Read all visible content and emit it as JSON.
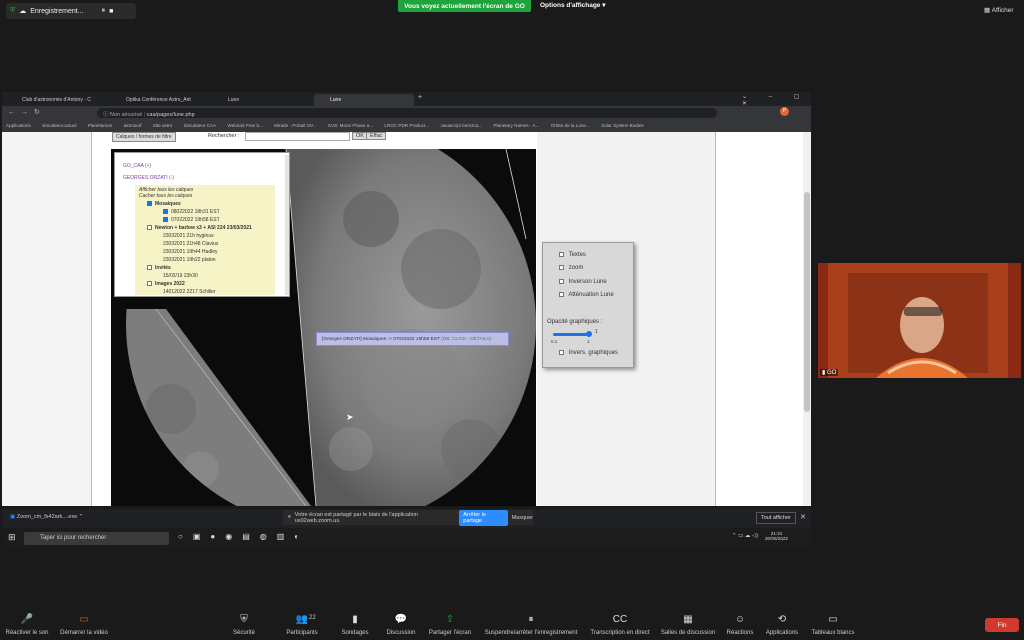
{
  "zoom_top": {
    "recording_label": "Enregistrement...",
    "share_banner": "Vous voyez actuellement l'écran de GO",
    "view_options": "Options d'affichage",
    "show_label": "Afficher"
  },
  "browser": {
    "tabs": [
      "Club d'astronomie d'Antony - C",
      "Optika Conférence Astro_Ant",
      "Lune",
      "Lune"
    ],
    "not_secure": "Non sécurisé",
    "url": "caa/pages/lune.php",
    "bookmarks": [
      "Applications",
      "simulateur.actuel",
      "Planétarium",
      "astrosurf",
      "Site astro",
      "Simulateur CAA",
      "Webirad Free b...",
      "Mirade - Portail OV...",
      "SVS: Moon Phase a...",
      "LROC PDR Product...",
      "Javascript tiers2ca...",
      "Planetary Names - A...",
      "Orbite de la Lune...",
      "Solar System Bodies"
    ]
  },
  "page": {
    "search_label": "Rechercher :",
    "btn_ok": "OK",
    "btn_clear": "Effac",
    "btn_top": "Calques / formes de filtre"
  },
  "layers": {
    "group1": "GO_CAA (+)",
    "group2": "GEORGES ORZATI (-)",
    "show_all": "Afficher tous les calques",
    "hide_all": "Cacher tous les calques",
    "items": [
      {
        "label": "Mosaiques",
        "checked": true,
        "bold": true,
        "indent": 0
      },
      {
        "label": "08022022 18h31 EST",
        "checked": true,
        "bold": false,
        "indent": 1
      },
      {
        "label": "07022022 19h58 EST",
        "checked": true,
        "bold": false,
        "indent": 1
      },
      {
        "label": "Newton + barlow x3 + ASI 224 23/03/2021",
        "checked": false,
        "bold": true,
        "indent": 0
      },
      {
        "label": "23032021 21h hyginus",
        "checked": null,
        "bold": false,
        "indent": 1
      },
      {
        "label": "23032021 21h48 Clavius",
        "checked": null,
        "bold": false,
        "indent": 1
      },
      {
        "label": "23032021 19h44 Hadley",
        "checked": null,
        "bold": false,
        "indent": 1
      },
      {
        "label": "23032021 19h22 platon",
        "checked": null,
        "bold": false,
        "indent": 1
      },
      {
        "label": "Invités",
        "checked": false,
        "bold": true,
        "indent": 0
      },
      {
        "label": "15/02/19 23h30",
        "checked": null,
        "bold": false,
        "indent": 1
      },
      {
        "label": "Images 2022",
        "checked": false,
        "bold": true,
        "indent": 0
      },
      {
        "label": "14012022 2217 Schiller",
        "checked": null,
        "bold": false,
        "indent": 1
      }
    ]
  },
  "tooltip": {
    "text": "[Georges ORZATI] Mosaiques -> 07022022 19h58 EST",
    "link": "(DB. CLICK : DÉTAILS)"
  },
  "options": {
    "items": [
      "Textes",
      "zoom",
      "Inverson Lune",
      "Atténuation Lune"
    ],
    "opacity_label": "Opacité graphiques :",
    "slider_max": "1",
    "slider_min": "0.1",
    "slider_value_label": "1",
    "opacity_value": 1.0,
    "invert_label": "Invers. graphiques"
  },
  "share_notice": {
    "text": "Votre écran est partagé par le biais de l'application us02web.zoom.us.",
    "stop": "Arrêter le partage",
    "hide": "Masquer"
  },
  "download_bar": {
    "file": "Zoom_cm_fs42ark....exe",
    "show_all": "Tout afficher"
  },
  "taskbar": {
    "search_placeholder": "Taper ici pour rechercher",
    "time": "21:31",
    "date": "20/05/2022"
  },
  "camera": {
    "name": "GO"
  },
  "zoom_bottom": {
    "buttons": [
      {
        "icon": "mic-off-icon",
        "label": "Réactiver le son",
        "glyph": "🎤"
      },
      {
        "icon": "video-off-icon",
        "label": "Démarrer la vidéo",
        "glyph": "▭"
      },
      {
        "icon": "shield-icon",
        "label": "Sécurité",
        "glyph": "⛨"
      },
      {
        "icon": "participants-icon",
        "label": "Participants",
        "glyph": "👥"
      },
      {
        "icon": "polls-icon",
        "label": "Sondages",
        "glyph": "▮"
      },
      {
        "icon": "chat-icon",
        "label": "Discussion",
        "glyph": "💬"
      },
      {
        "icon": "share-screen-icon",
        "label": "Partager l'écran",
        "glyph": "⇧"
      },
      {
        "icon": "pause-record-icon",
        "label": "Suspendre/arrêter l'enregistrement",
        "glyph": "⏸"
      },
      {
        "icon": "captions-icon",
        "label": "Transcription en direct",
        "glyph": "CC"
      },
      {
        "icon": "breakout-icon",
        "label": "Salles de discussion",
        "glyph": "▦"
      },
      {
        "icon": "reactions-icon",
        "label": "Réactions",
        "glyph": "☺"
      },
      {
        "icon": "apps-icon",
        "label": "Applications",
        "glyph": "⟲"
      },
      {
        "icon": "whiteboard-icon",
        "label": "Tableaux blancs",
        "glyph": "▭"
      }
    ],
    "participants_count": "22",
    "end": "Fin"
  },
  "colors": {
    "share_green": "#1fa33b",
    "zoom_blue": "#2d8cff",
    "end_red": "#d03a2e"
  }
}
